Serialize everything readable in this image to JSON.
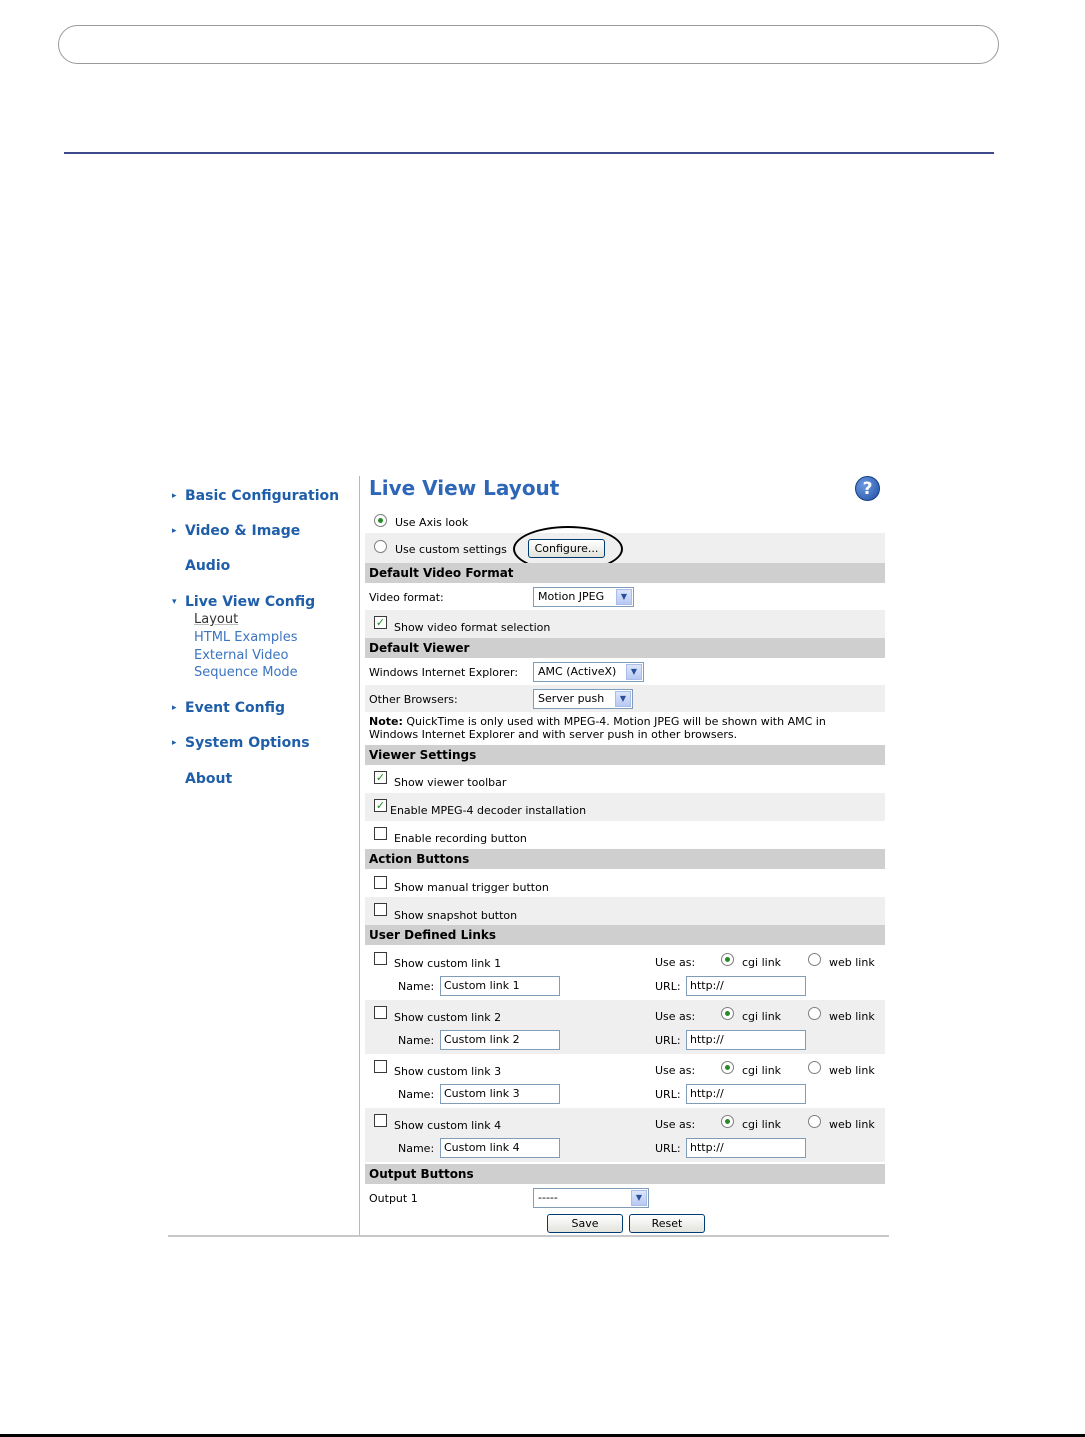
{
  "nav": {
    "items": [
      {
        "label": "Basic Configuration",
        "arrow": "▸"
      },
      {
        "label": "Video & Image",
        "arrow": "▸"
      },
      {
        "label": "Audio",
        "arrow": ""
      },
      {
        "label": "Live View Config",
        "arrow": "▾"
      },
      {
        "label": "Event Config",
        "arrow": "▸"
      },
      {
        "label": "System Options",
        "arrow": "▸"
      },
      {
        "label": "About",
        "arrow": ""
      }
    ],
    "live_view_sub": [
      "Layout",
      "HTML Examples",
      "External Video",
      "Sequence Mode"
    ],
    "active_sub": "Layout"
  },
  "page": {
    "title": "Live View Layout",
    "help_glyph": "?"
  },
  "layout_choice": {
    "axis_look": "Use Axis look",
    "custom_settings": "Use custom settings",
    "configure_button": "Configure...",
    "selected": "axis_look"
  },
  "default_video_format": {
    "header": "Default Video Format",
    "video_format_label": "Video format:",
    "video_format_value": "Motion JPEG",
    "show_selection_label": "Show video format selection",
    "show_selection_checked": true
  },
  "default_viewer": {
    "header": "Default Viewer",
    "ie_label": "Windows Internet Explorer:",
    "ie_value": "AMC (ActiveX)",
    "other_label": "Other Browsers:",
    "other_value": "Server push",
    "note_bold": "Note:",
    "note_line1": " QuickTime is only used with MPEG-4. Motion JPEG will be shown with AMC in",
    "note_line2": "Windows Internet Explorer and with server push in other browsers."
  },
  "viewer_settings": {
    "header": "Viewer Settings",
    "toolbar_label": "Show viewer toolbar",
    "toolbar_checked": true,
    "mpeg4_label": "Enable MPEG-4 decoder installation",
    "mpeg4_checked": true,
    "recording_label": "Enable recording button",
    "recording_checked": false
  },
  "action_buttons": {
    "header": "Action Buttons",
    "manual_trigger_label": "Show manual trigger button",
    "snapshot_label": "Show snapshot button"
  },
  "user_links": {
    "header": "User Defined Links",
    "use_as_label": "Use as:",
    "cgi_label": "cgi link",
    "web_label": "web link",
    "name_label": "Name:",
    "url_label": "URL:",
    "links": [
      {
        "show_label": "Show custom link 1",
        "name": "Custom link 1",
        "url": "http://"
      },
      {
        "show_label": "Show custom link 2",
        "name": "Custom link 2",
        "url": "http://"
      },
      {
        "show_label": "Show custom link 3",
        "name": "Custom link 3",
        "url": "http://"
      },
      {
        "show_label": "Show custom link 4",
        "name": "Custom link 4",
        "url": "http://"
      }
    ]
  },
  "output_buttons": {
    "header": "Output Buttons",
    "output_label": "Output 1",
    "output_value": "-----"
  },
  "form_buttons": {
    "save": "Save",
    "reset": "Reset"
  },
  "colors": {
    "nav_link": "#1f5ea8",
    "title": "#2e66b8",
    "section_bg": "#cfcfcf",
    "row_alt_bg": "#efefef",
    "rule": "#3f4a8c"
  }
}
